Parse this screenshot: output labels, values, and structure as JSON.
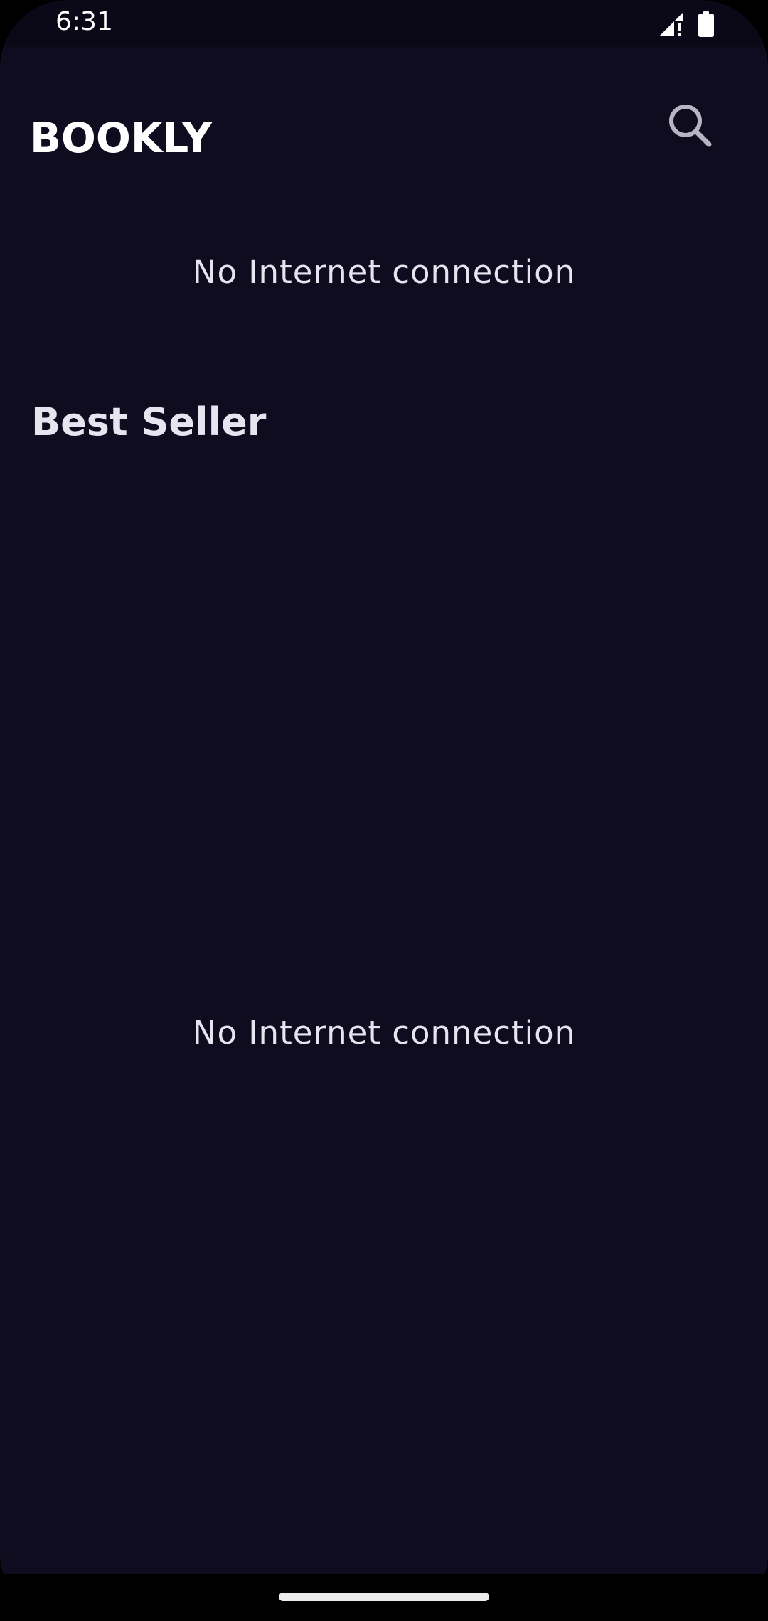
{
  "status_bar": {
    "time": "6:31"
  },
  "app_bar": {
    "logo_text": "BOOKLY",
    "search_icon": "search-icon"
  },
  "featured": {
    "message": "No Internet connection"
  },
  "best_seller": {
    "title": "Best Seller",
    "message": "No Internet connection"
  },
  "colors": {
    "background": "#100c20",
    "status_bar": "#0b0818",
    "text": "#e7e3ef"
  }
}
